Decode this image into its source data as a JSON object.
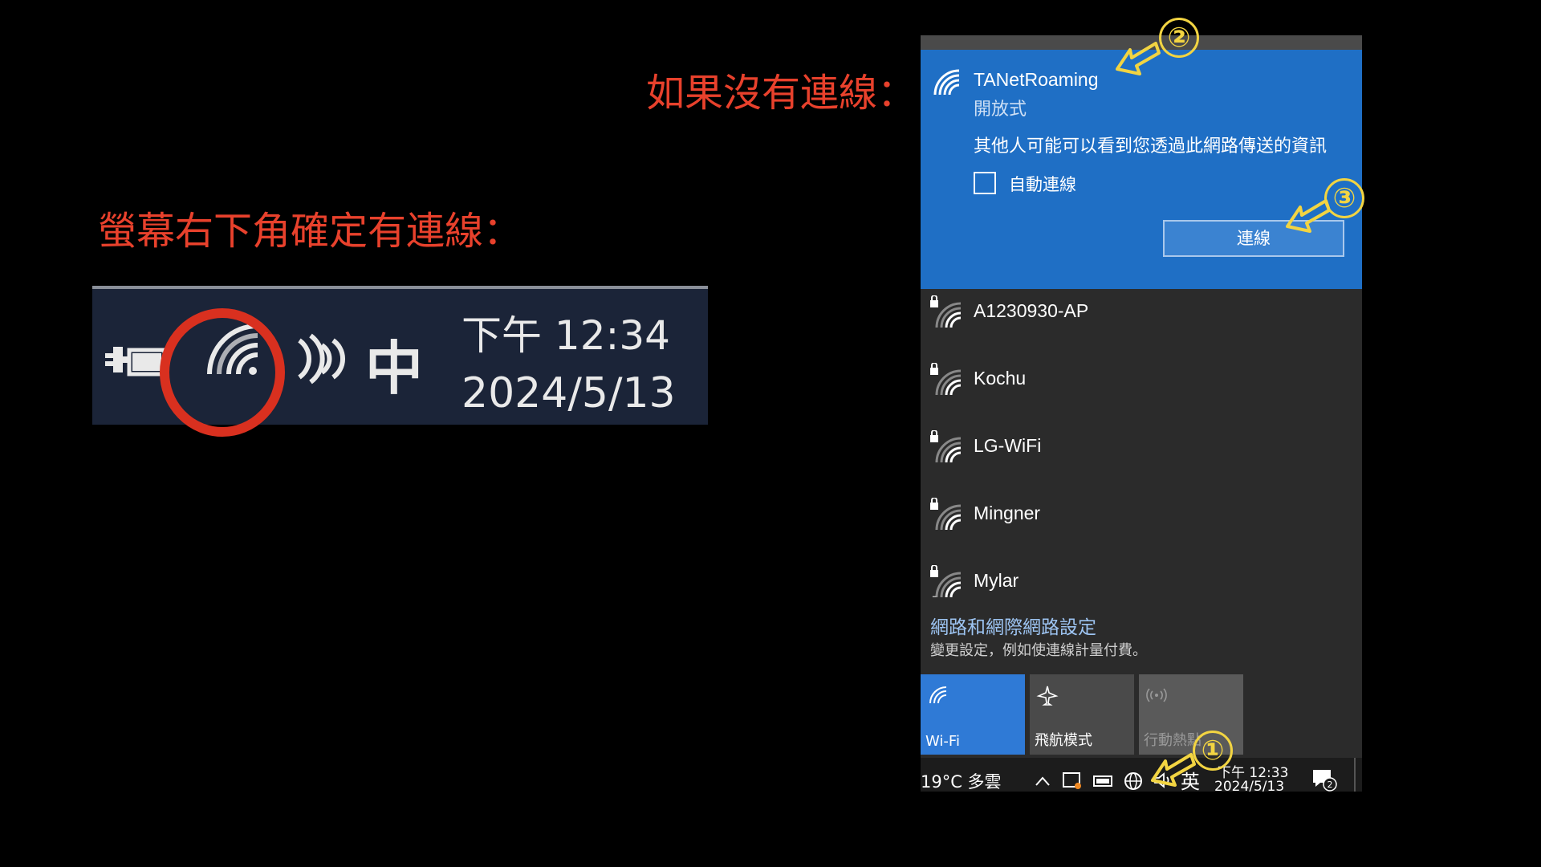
{
  "captions": {
    "no_connection": "如果沒有連線：",
    "confirm_connection": "螢幕右下角確定有連線："
  },
  "taskbar_zoom": {
    "ime": "中",
    "time": "下午 12:34",
    "date": "2024/5/13"
  },
  "selected_network": {
    "name": "TANetRoaming",
    "security": "開放式",
    "warning": "其他人可能可以看到您透過此網路傳送的資訊",
    "auto_connect_label": "自動連線",
    "auto_connect_checked": false,
    "connect_button": "連線"
  },
  "networks": [
    {
      "name": "A1230930-AP",
      "secured": true
    },
    {
      "name": "Kochu",
      "secured": true
    },
    {
      "name": "LG-WiFi",
      "secured": true
    },
    {
      "name": "Mingner",
      "secured": true
    },
    {
      "name": "Mylar",
      "secured": true
    }
  ],
  "dash": "-",
  "settings": {
    "link": "網路和網際網路設定",
    "sub": "變更設定，例如使連線計量付費。"
  },
  "quick_actions": [
    {
      "label": "Wi-Fi",
      "icon": "wifi-icon",
      "active": true
    },
    {
      "label": "飛航模式",
      "icon": "airplane-icon",
      "active": false
    },
    {
      "label": "行動熱點",
      "icon": "hotspot-icon",
      "active": false
    }
  ],
  "tray": {
    "weather": "19°C  多雲",
    "ime": "英",
    "time": "下午 12:33",
    "date": "2024/5/13",
    "notification_count": "2"
  },
  "step_marks": [
    "①",
    "②",
    "③"
  ],
  "colors": {
    "accent": "#1f6fc5",
    "caption": "#e8412c",
    "marker": "#f2d442",
    "circle": "#d9301f"
  }
}
